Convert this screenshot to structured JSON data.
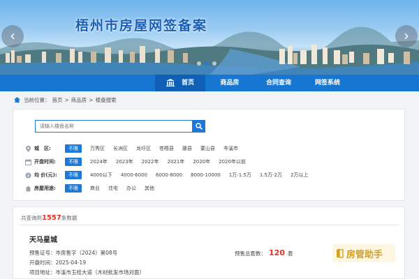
{
  "banner": {
    "title": "梧州市房屋网签备案",
    "prev_glyph": "‹",
    "next_glyph": "›",
    "slide_count": 3,
    "active_slide": 2
  },
  "nav": {
    "items": [
      "首页",
      "商品房",
      "合同查询",
      "网签系统"
    ],
    "active": "首页"
  },
  "breadcrumb": {
    "prefix": "当前位置：",
    "items": [
      "首页",
      "商品房",
      "楼盘搜索"
    ],
    "separator": ">"
  },
  "search": {
    "placeholder": "请输入楼盘名称",
    "icon": "search-icon"
  },
  "filters": {
    "district": {
      "label": "城　区:",
      "options": [
        "不限",
        "万秀区",
        "长洲区",
        "龙圩区",
        "苍梧县",
        "藤县",
        "蒙山县",
        "岑溪市"
      ],
      "selected": "不限"
    },
    "open_time": {
      "label": "开盘时间:",
      "options": [
        "不限",
        "2024年",
        "2023年",
        "2022年",
        "2021年",
        "2020年",
        "2020年以前"
      ],
      "selected": "不限"
    },
    "price": {
      "label": "均 价(元):",
      "options": [
        "不限",
        "4000以下",
        "4000-6000",
        "6000-8000",
        "8000-10000",
        "1万-1.5万",
        "1.5万-2万",
        "2万以上"
      ],
      "selected": "不限"
    },
    "usage": {
      "label": "房屋用途:",
      "options": [
        "不限",
        "商业",
        "住宅",
        "办公",
        "其他"
      ],
      "selected": "不限"
    }
  },
  "result": {
    "count_prefix": "共查询到",
    "count": "1557",
    "count_suffix": "条数据",
    "project": {
      "name": "天马星城",
      "permit_label": "预售证号：",
      "permit_value": "岑房售字（2024）第08号",
      "open_label": "开盘时间：",
      "open_value": "2025-04-19",
      "address_label": "项目地址：",
      "address_value": "岑溪市玉桂大道（木材批发市场对面）",
      "presale_label": "预售总套数：",
      "presale_value": "120",
      "presale_unit": "套"
    }
  },
  "watermark": {
    "text": "房管助手"
  },
  "colors": {
    "primary": "#1676d2",
    "highlight": "#e5331f",
    "watermark": "#d4a028"
  }
}
